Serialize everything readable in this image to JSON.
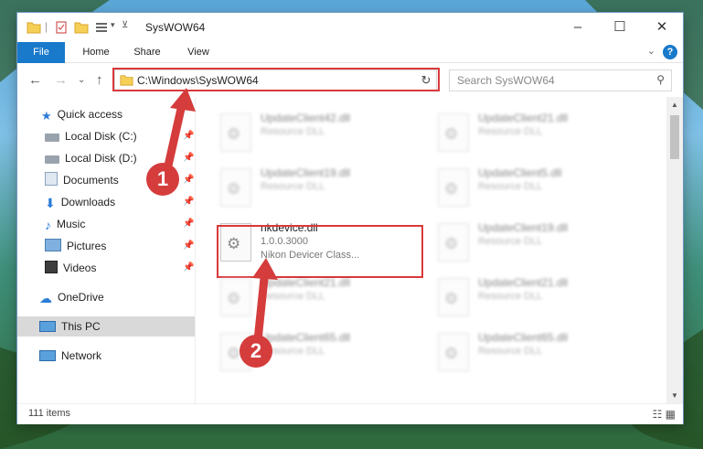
{
  "window": {
    "title": "SysWOW64",
    "minimize_glyph": "–",
    "maximize_glyph": "☐",
    "close_glyph": "✕"
  },
  "ribbon": {
    "tabs": [
      "File",
      "Home",
      "Share",
      "View"
    ],
    "help_glyph": "?",
    "expand_glyph": "⌄"
  },
  "navbar": {
    "back_glyph": "←",
    "forward_glyph": "→",
    "recent_glyph": "⌄",
    "up_glyph": "↑",
    "address": "C:\\Windows\\SysWOW64",
    "address_dropdown_glyph": "⌄",
    "refresh_glyph": "↻",
    "search_placeholder": "Search SysWOW64",
    "search_glyph": "⚲"
  },
  "sidebar": {
    "items": [
      {
        "label": "Quick access",
        "icon": "star-icon",
        "pinned": false
      },
      {
        "label": "Local Disk (C:)",
        "icon": "drive-icon",
        "pinned": true
      },
      {
        "label": "Local Disk (D:)",
        "icon": "drive-icon",
        "pinned": true
      },
      {
        "label": "Documents",
        "icon": "documents-icon",
        "pinned": true
      },
      {
        "label": "Downloads",
        "icon": "download-icon",
        "pinned": true
      },
      {
        "label": "Music",
        "icon": "music-icon",
        "pinned": true
      },
      {
        "label": "Pictures",
        "icon": "pictures-icon",
        "pinned": true
      },
      {
        "label": "Videos",
        "icon": "videos-icon",
        "pinned": true
      },
      {
        "label": "OneDrive",
        "icon": "cloud-icon",
        "pinned": false
      },
      {
        "label": "This PC",
        "icon": "computer-icon",
        "pinned": false
      },
      {
        "label": "Network",
        "icon": "network-icon",
        "pinned": false
      }
    ],
    "pin_glyph": "📌"
  },
  "files": {
    "left": [
      {
        "name": "UpdateClient42.dll",
        "type": "Resource DLL"
      },
      {
        "name": "UpdateClient19.dll",
        "type": "Resource DLL"
      },
      {
        "name": "nkdevice.dll",
        "version": "1.0.0.3000",
        "description": "Nikon Devicer Class..."
      },
      {
        "name": "UpdateClient21.dll",
        "type": "Resource DLL"
      },
      {
        "name": "UpdateClient65.dll",
        "type": "Resource DLL"
      }
    ],
    "right": [
      {
        "name": "UpdateClient21.dll",
        "type": "Resource DLL"
      },
      {
        "name": "UpdateClient5.dll",
        "type": "Resource DLL"
      },
      {
        "name": "UpdateClient19.dll",
        "type": "Resource DLL"
      },
      {
        "name": "UpdateClient21.dll",
        "type": "Resource DLL"
      },
      {
        "name": "UpdateClient65.dll",
        "type": "Resource DLL"
      }
    ]
  },
  "status": {
    "item_count": "111 items",
    "view_glyphs": "☷ ▦"
  },
  "annotations": {
    "marker1": "1",
    "marker2": "2",
    "highlight_color": "#d9393b"
  }
}
